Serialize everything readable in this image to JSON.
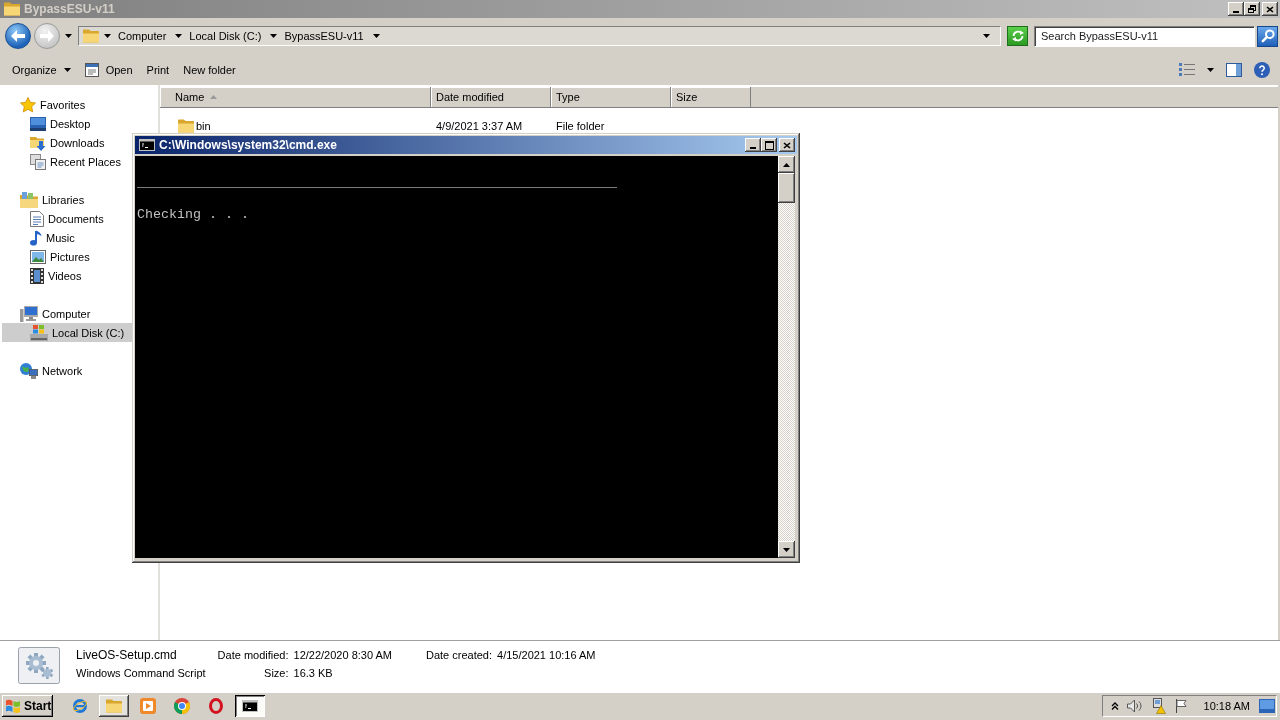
{
  "explorer": {
    "title": "BypassESU-v11",
    "active": false
  },
  "navigation": {
    "back": {
      "disabled": false
    },
    "forward": {
      "disabled": true
    }
  },
  "address_bar": {
    "breadcrumbs": [
      "Computer",
      "Local Disk (C:)",
      "BypassESU-v11"
    ]
  },
  "search": {
    "placeholder": "Search BypassESU-v11"
  },
  "toolbar": {
    "buttons": [
      {
        "label": "Organize",
        "kind": "menu"
      },
      {
        "label": "Open",
        "kind": "icon"
      },
      {
        "label": "Print",
        "kind": "plain"
      },
      {
        "label": "New folder",
        "kind": "plain"
      }
    ]
  },
  "sidebar": {
    "groups": [
      {
        "label": "Favorites",
        "selected": false,
        "children": [
          {
            "label": "Desktop",
            "selected": false
          },
          {
            "label": "Downloads",
            "selected": false
          },
          {
            "label": "Recent Places",
            "selected": false
          }
        ]
      },
      {
        "label": "Libraries",
        "selected": false,
        "children": [
          {
            "label": "Documents",
            "selected": false
          },
          {
            "label": "Music",
            "selected": false
          },
          {
            "label": "Pictures",
            "selected": false
          },
          {
            "label": "Videos",
            "selected": false
          }
        ]
      },
      {
        "label": "Computer",
        "selected": false,
        "children": [
          {
            "label": "Local Disk (C:)",
            "selected": true
          }
        ]
      },
      {
        "label": "Network",
        "selected": false
      }
    ]
  },
  "table": {
    "columns": [
      {
        "label": "Name",
        "sorted": true
      },
      {
        "label": "Date modified",
        "sorted": false
      },
      {
        "label": "Type",
        "sorted": false
      },
      {
        "label": "Size",
        "sorted": false
      }
    ],
    "rows": [
      {
        "name": "bin",
        "date_modified": "4/9/2021 3:37 AM",
        "type": "File folder"
      }
    ]
  },
  "details": {
    "file_name": "LiveOS-Setup.cmd",
    "file_type": "Windows Command Script",
    "fields": [
      {
        "label": "Date modified:",
        "value": "12/22/2020 8:30 AM"
      },
      {
        "label": "Size:",
        "value": "16.3 KB"
      },
      {
        "label": "Date created:",
        "value": "4/15/2021 10:16 AM"
      }
    ]
  },
  "console": {
    "title": "C:\\Windows\\system32\\cmd.exe",
    "active": true,
    "lines": [
      "____________________________________________________________",
      "Checking . . ."
    ]
  },
  "taskbar": {
    "start": "Start",
    "items": [
      {
        "running": false,
        "selected": false
      },
      {
        "running": true,
        "selected": false
      },
      {
        "running": false,
        "selected": false
      },
      {
        "running": false,
        "selected": false
      },
      {
        "running": false,
        "selected": false
      },
      {
        "running": true,
        "selected": true
      }
    ],
    "clock": "10:18 AM"
  }
}
